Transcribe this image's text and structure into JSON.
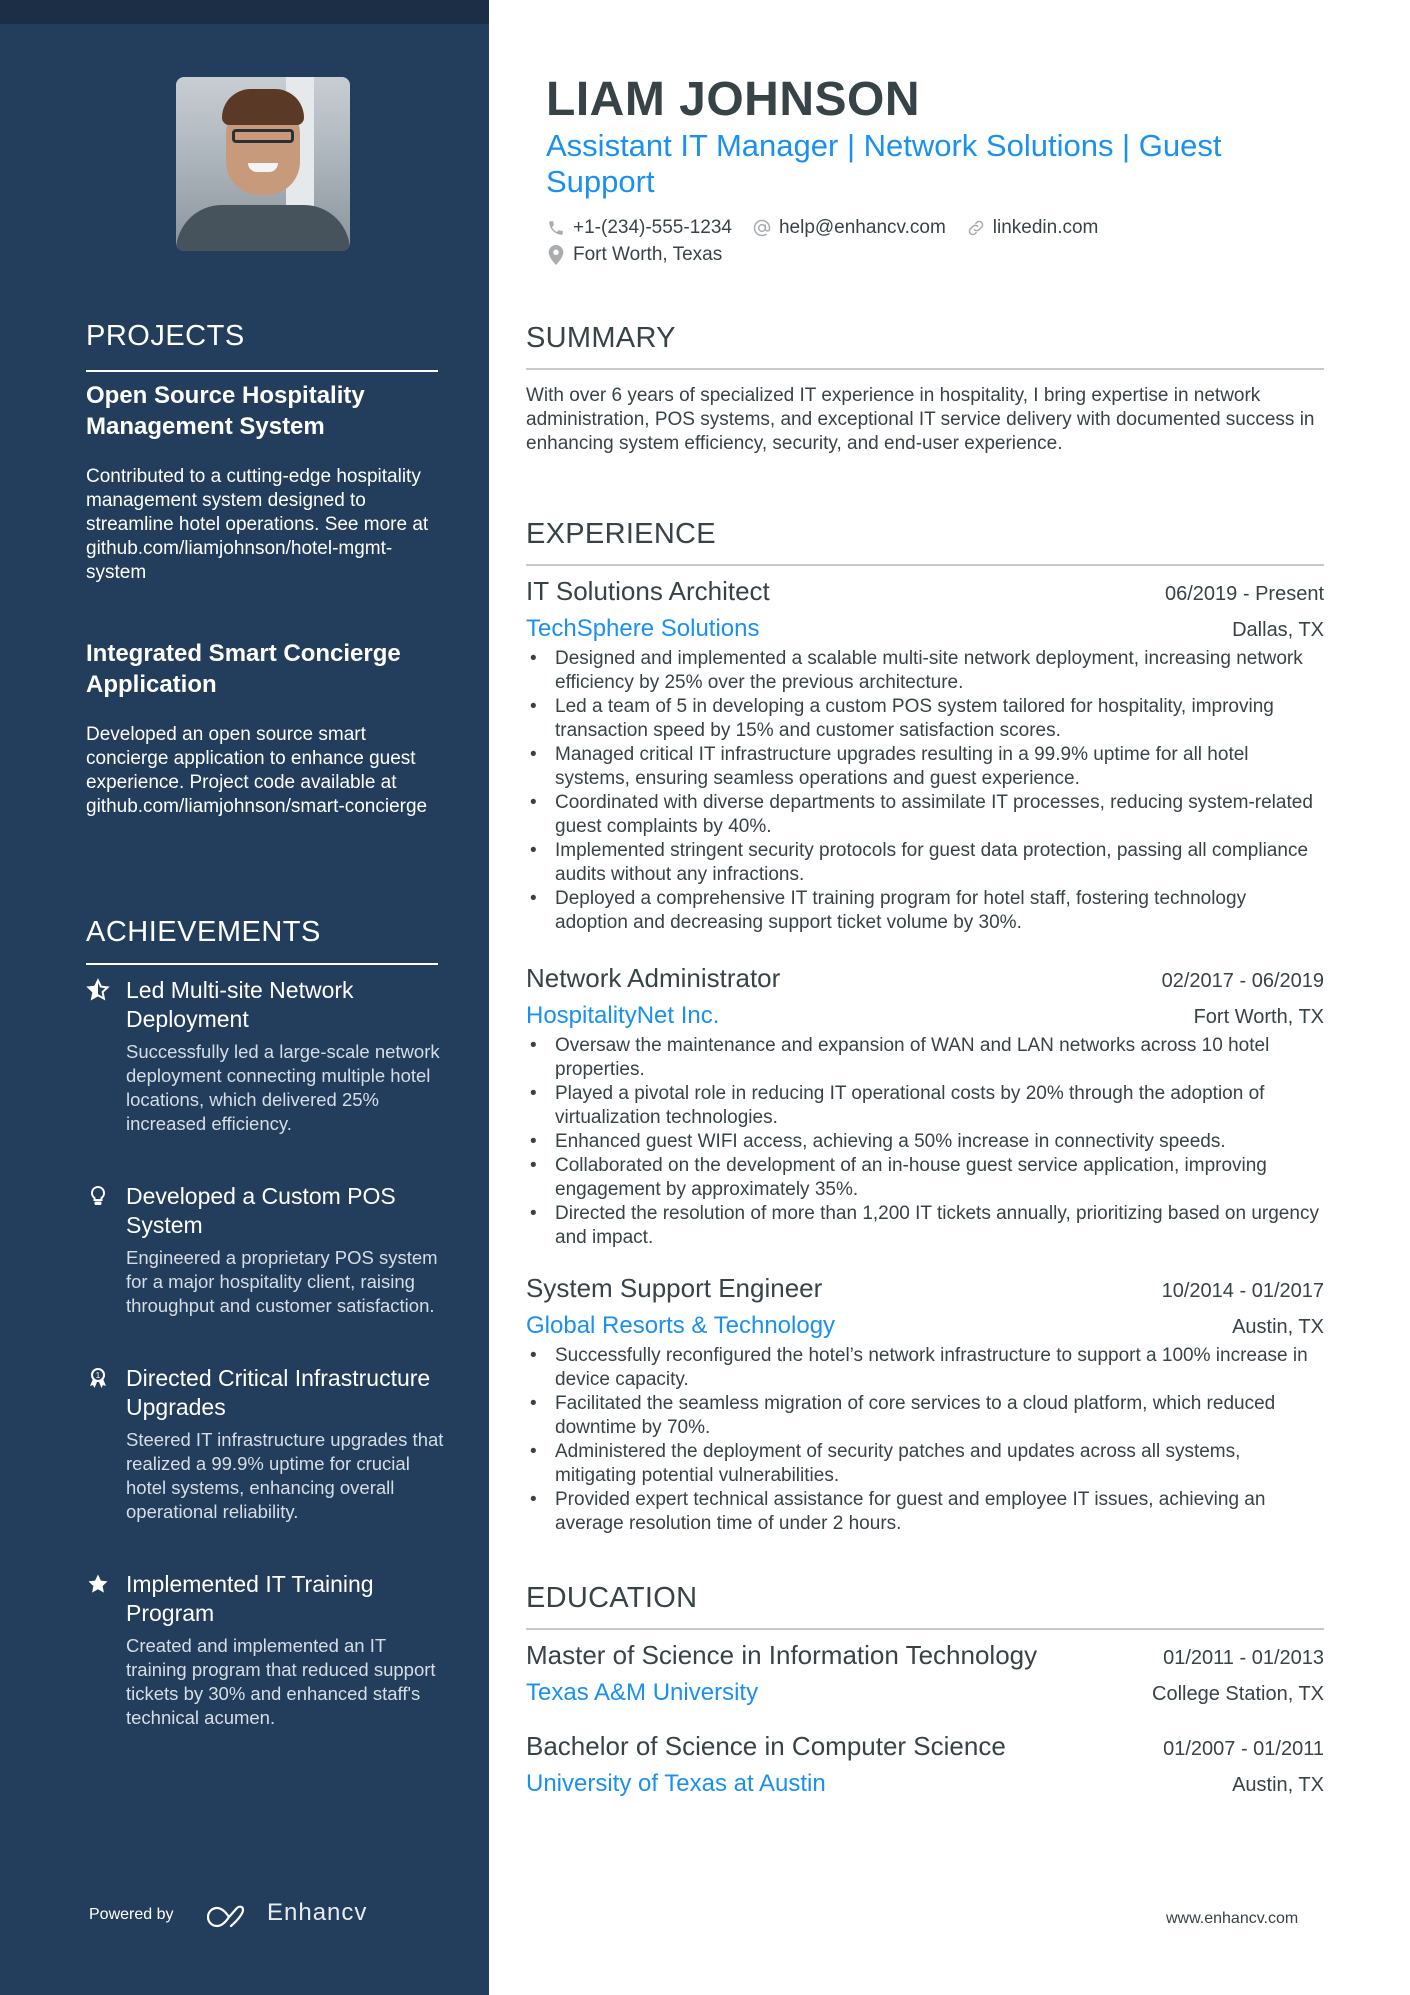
{
  "colors": {
    "sidebar": "#223E5C",
    "accent": "#1A91F0",
    "text": "#384347"
  },
  "header": {
    "name": "LIAM JOHNSON",
    "headline": "Assistant IT Manager | Network Solutions | Guest Support",
    "contacts": [
      {
        "icon": "phone-icon",
        "text": "+1-(234)-555-1234"
      },
      {
        "icon": "at-icon",
        "text": "help@enhancv.com"
      },
      {
        "icon": "link-icon",
        "text": "linkedin.com"
      },
      {
        "icon": "location-pin-icon",
        "text": "Fort Worth, Texas"
      }
    ]
  },
  "sidebar": {
    "projects_title": "PROJECTS",
    "projects": [
      {
        "title": "Open Source Hospitality Management System",
        "description": "Contributed to a cutting-edge hospitality management system designed to streamline hotel operations. See more at github.com/liamjohnson/hotel-mgmt-system"
      },
      {
        "title": "Integrated Smart Concierge Application",
        "description": "Developed an open source smart concierge application to enhance guest experience. Project code available at github.com/liamjohnson/smart-concierge"
      }
    ],
    "achievements_title": "ACHIEVEMENTS",
    "achievements": [
      {
        "icon": "star-outline-icon",
        "title": "Led Multi-site Network Deployment",
        "description": "Successfully led a large-scale network deployment connecting multiple hotel locations, which delivered 25% increased efficiency."
      },
      {
        "icon": "lightbulb-icon",
        "title": "Developed a Custom POS System",
        "description": "Engineered a proprietary POS system for a major hospitality client, raising throughput and customer satisfaction."
      },
      {
        "icon": "award-medal-icon",
        "title": "Directed Critical Infrastructure Upgrades",
        "description": "Steered IT infrastructure upgrades that realized a 99.9% uptime for crucial hotel systems, enhancing overall operational reliability."
      },
      {
        "icon": "star-filled-icon",
        "title": "Implemented IT Training Program",
        "description": "Created and implemented an IT training program that reduced support tickets by 30% and enhanced staff's technical acumen."
      }
    ],
    "powered_by": "Powered by",
    "brand": "Enhancv"
  },
  "summary": {
    "title": "SUMMARY",
    "text": "With over 6 years of specialized IT experience in hospitality, I bring expertise in network administration, POS systems, and exceptional IT service delivery with documented success in enhancing system efficiency, security, and end-user experience."
  },
  "experience": {
    "title": "EXPERIENCE",
    "jobs": [
      {
        "title": "IT Solutions Architect",
        "dates": "06/2019 - Present",
        "company": "TechSphere Solutions",
        "location": "Dallas, TX",
        "bullets": [
          "Designed and implemented a scalable multi-site network deployment, increasing network efficiency by 25% over the previous architecture.",
          "Led a team of 5 in developing a custom POS system tailored for hospitality, improving transaction speed by 15% and customer satisfaction scores.",
          "Managed critical IT infrastructure upgrades resulting in a 99.9% uptime for all hotel systems, ensuring seamless operations and guest experience.",
          "Coordinated with diverse departments to assimilate IT processes, reducing system-related guest complaints by 40%.",
          "Implemented stringent security protocols for guest data protection, passing all compliance audits without any infractions.",
          "Deployed a comprehensive IT training program for hotel staff, fostering technology adoption and decreasing support ticket volume by 30%."
        ]
      },
      {
        "title": "Network Administrator",
        "dates": "02/2017 - 06/2019",
        "company": "HospitalityNet Inc.",
        "location": "Fort Worth, TX",
        "bullets": [
          "Oversaw the maintenance and expansion of WAN and LAN networks across 10 hotel properties.",
          "Played a pivotal role in reducing IT operational costs by 20% through the adoption of virtualization technologies.",
          "Enhanced guest WIFI access, achieving a 50% increase in connectivity speeds.",
          "Collaborated on the development of an in-house guest service application, improving engagement by approximately 35%.",
          "Directed the resolution of more than 1,200 IT tickets annually, prioritizing based on urgency and impact."
        ]
      },
      {
        "title": "System Support Engineer",
        "dates": "10/2014 - 01/2017",
        "company": "Global Resorts & Technology",
        "location": "Austin, TX",
        "bullets": [
          "Successfully reconfigured the hotel’s network infrastructure to support a 100% increase in device capacity.",
          "Facilitated the seamless migration of core services to a cloud platform, which reduced downtime by 70%.",
          "Administered the deployment of security patches and updates across all systems, mitigating potential vulnerabilities.",
          "Provided expert technical assistance for guest and employee IT issues, achieving an average resolution time of under 2 hours."
        ]
      }
    ]
  },
  "education": {
    "title": "EDUCATION",
    "items": [
      {
        "degree": "Master of Science in Information Technology",
        "dates": "01/2011 - 01/2013",
        "school": "Texas A&M University",
        "location": "College Station, TX"
      },
      {
        "degree": "Bachelor of Science in Computer Science",
        "dates": "01/2007 - 01/2011",
        "school": "University of Texas at Austin",
        "location": "Austin, TX"
      }
    ]
  },
  "footer": {
    "website": "www.enhancv.com"
  }
}
